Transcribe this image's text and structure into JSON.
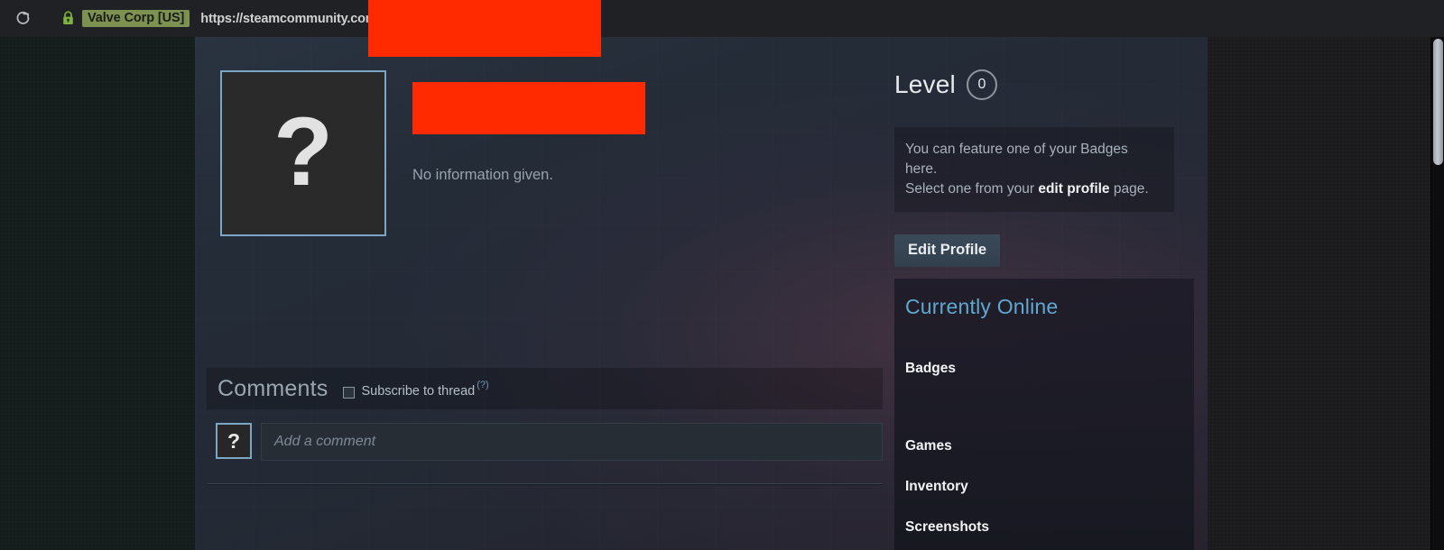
{
  "browser": {
    "reload_icon": "reload-icon",
    "lock_icon": "lock-icon",
    "ev_certificate": "Valve Corp [US]",
    "url": "https://steamcommunity.com/profiles/"
  },
  "profile": {
    "avatar_glyph": "?",
    "avatar_icon": "default-avatar-question-icon",
    "username_redacted": true,
    "bio": "No information given."
  },
  "level": {
    "label": "Level",
    "value": "0"
  },
  "badge_showcase": {
    "line1_before": "You can feature one of your Badges here.",
    "line2_before": "Select one from your ",
    "link": "edit profile",
    "line2_after": " page."
  },
  "buttons": {
    "edit_profile": "Edit Profile"
  },
  "sidebar": {
    "status": "Currently Online",
    "items": [
      {
        "label": "Badges"
      },
      {
        "label": "Games"
      },
      {
        "label": "Inventory"
      },
      {
        "label": "Screenshots"
      }
    ]
  },
  "comments": {
    "title": "Comments",
    "subscribe_label": "Subscribe to thread",
    "help_marker": "(?)",
    "input_placeholder": "Add a comment",
    "mini_avatar_glyph": "?"
  },
  "colors": {
    "accent_blue": "#5fa8cf",
    "avatar_border": "#7ca7c4",
    "ev_badge_bg": "#7d9150",
    "redaction": "#ff2a00"
  }
}
